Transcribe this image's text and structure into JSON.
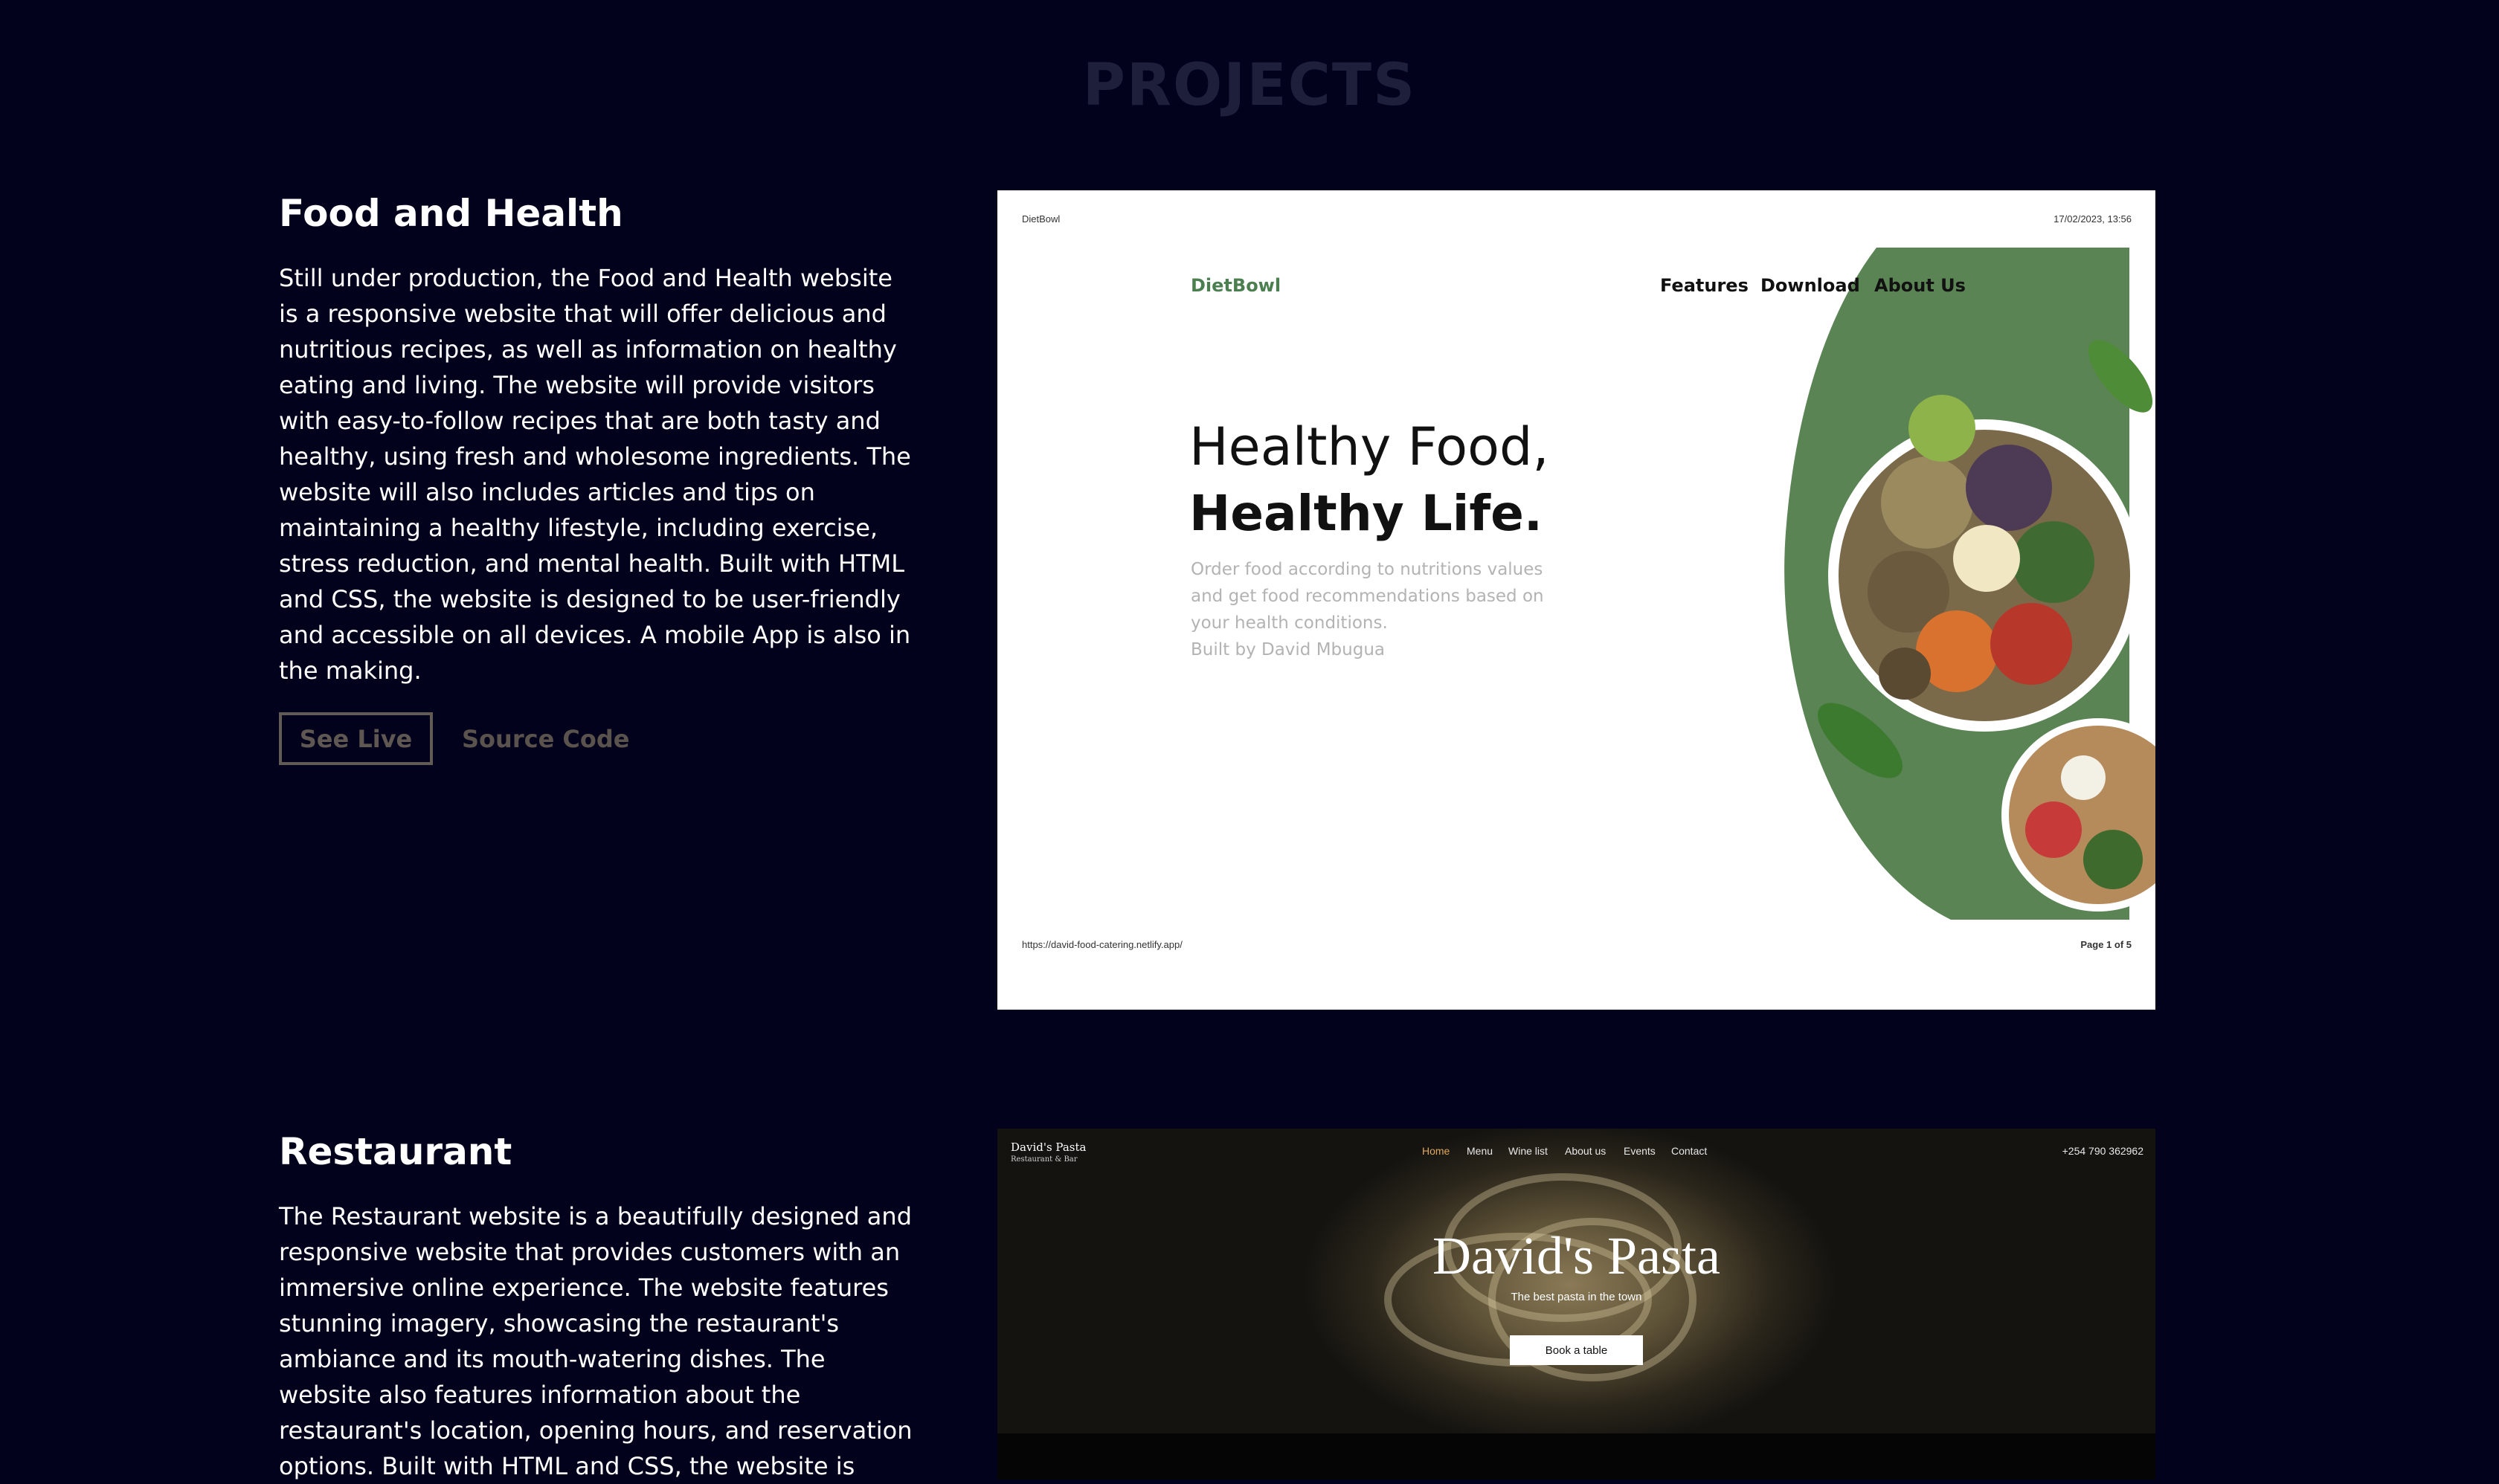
{
  "section": {
    "title": "PROJECTS"
  },
  "projects": [
    {
      "title": "Food and Health",
      "description": "Still under production, the Food and Health website is a responsive website that will offer delicious and nutritious recipes, as well as information on healthy eating and living. The website will provide visitors with easy-to-follow recipes that are both tasty and healthy, using fresh and wholesome ingredients. The website will also includes articles and tips on maintaining a healthy lifestyle, including exercise, stress reduction, and mental health. Built with HTML and CSS, the website is designed to be user-friendly and accessible on all devices. A mobile App is also in the making.",
      "see_live_label": "See Live",
      "source_code_label": "Source Code",
      "preview": {
        "page_header_left": "DietBowl",
        "page_header_right": "17/02/2023, 13:56",
        "logo": "DietBowl",
        "nav": [
          "Features",
          "Download",
          "About Us"
        ],
        "hero_line1": "Healthy Food,",
        "hero_line2": "Healthy Life.",
        "hero_sub": "Order food according to nutritions values and get food recommendations based on your health conditions.",
        "hero_credit": "Built by David Mbugua",
        "page_footer_left": "https://david-food-catering.netlify.app/",
        "page_footer_right": "Page 1 of 5",
        "accent_color": "#5b8455"
      }
    },
    {
      "title": "Restaurant",
      "description": "The Restaurant website is a beautifully designed and responsive website that provides customers with an immersive online experience. The website features stunning imagery, showcasing the restaurant's ambiance and its mouth-watering dishes. The website also features information about the restaurant's location, opening hours, and reservation options. Built with HTML and CSS, the website is",
      "preview": {
        "brand": "David's Pasta",
        "brand_sub": "Restaurant & Bar",
        "nav": [
          "Home",
          "Menu",
          "Wine list",
          "About us",
          "Events",
          "Contact"
        ],
        "phone": "+254 790 362962",
        "hero_title": "David's Pasta",
        "hero_tagline": "The best pasta in the town",
        "cta": "Book a table",
        "nav_active_color": "#e0a85a"
      }
    }
  ],
  "colors": {
    "background": "#03021d",
    "section_title": "#1d1f3b",
    "button_text": "#5f5752"
  }
}
